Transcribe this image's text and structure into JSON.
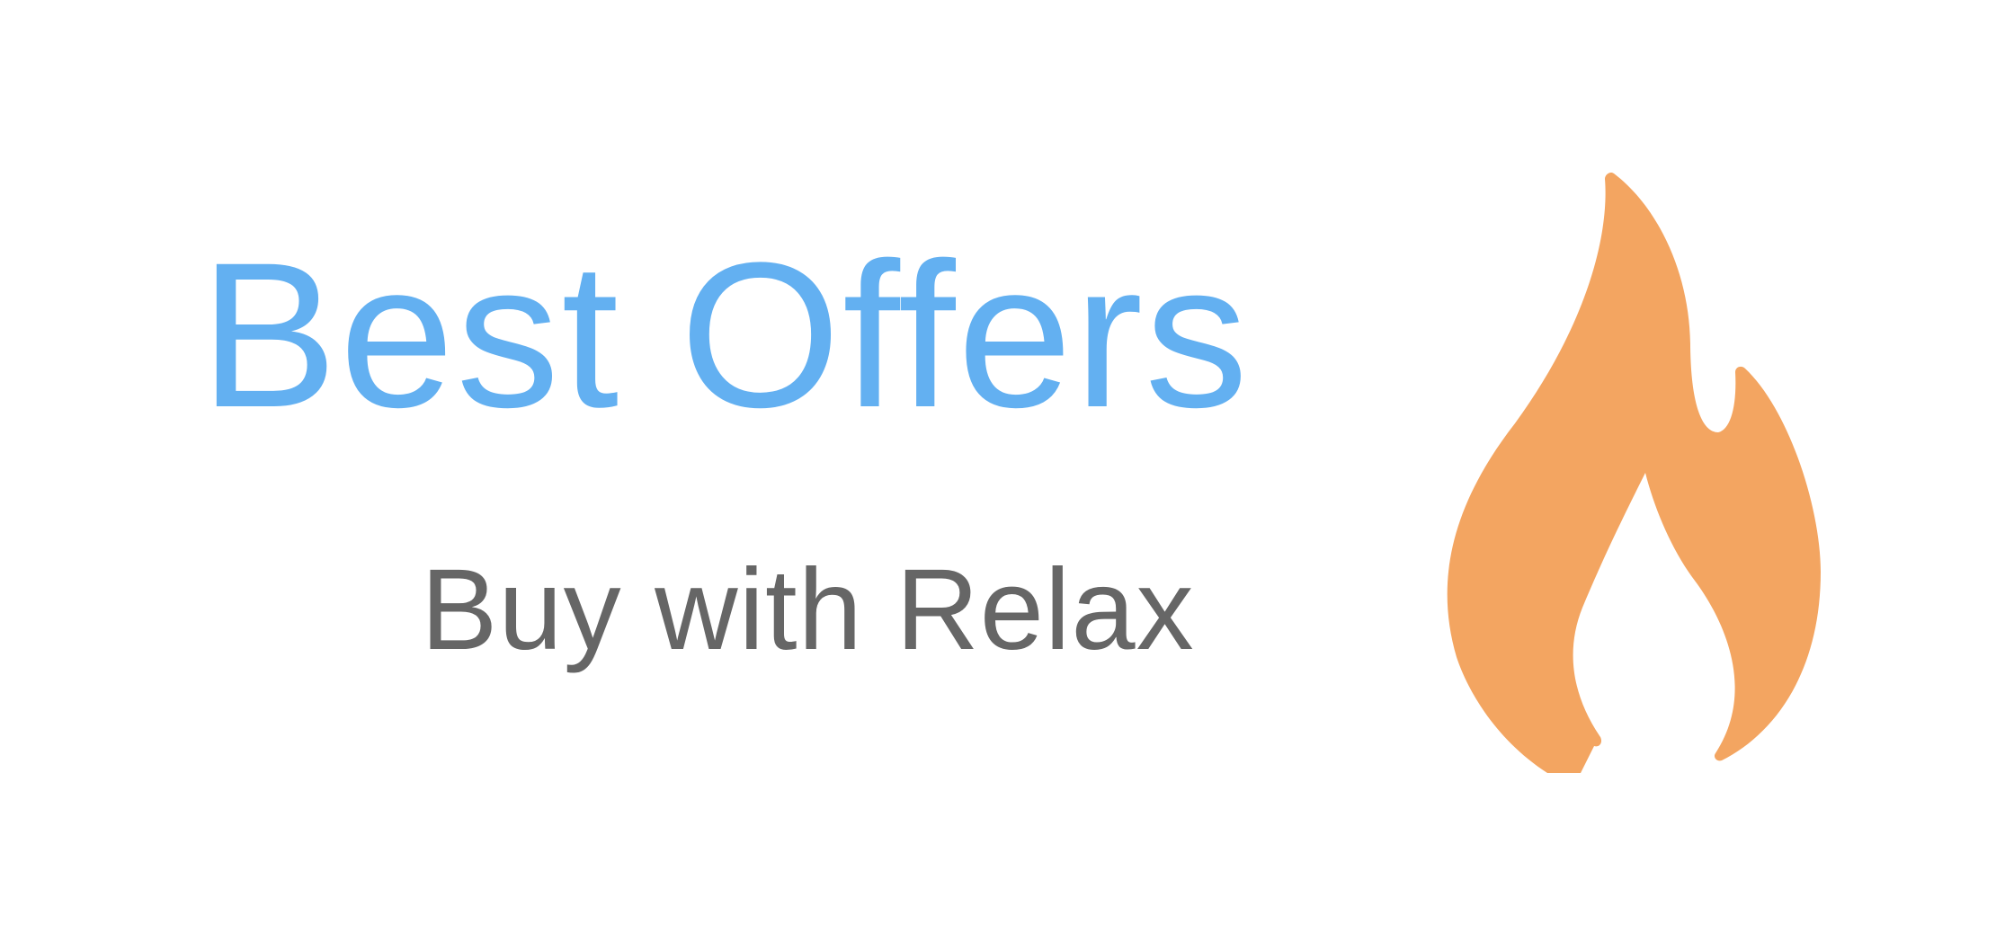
{
  "banner": {
    "headline": "Best Offers",
    "tagline": "Buy with Relax",
    "icon": "flame-icon"
  },
  "colors": {
    "headline": "#63b0f1",
    "tagline": "#666666",
    "flame": "#f3a561",
    "background": "#ffffff"
  }
}
